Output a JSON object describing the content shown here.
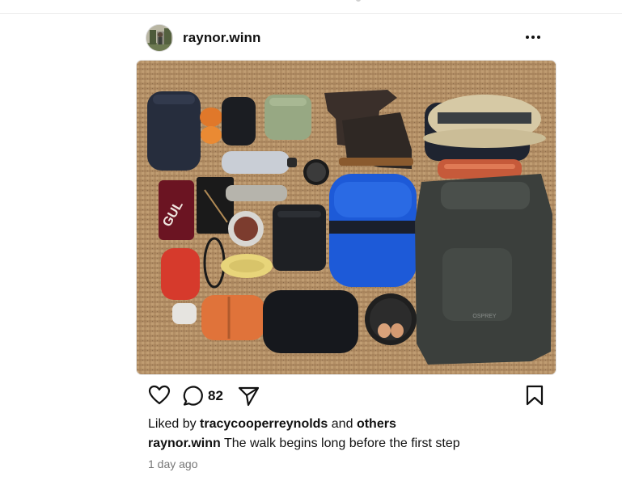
{
  "post": {
    "username": "raynor.winn",
    "comment_count": "82",
    "likes": {
      "prefix": "Liked by",
      "user": "tracycooperreynolds",
      "joiner": "and",
      "suffix": "others"
    },
    "caption": {
      "username": "raynor.winn",
      "text": "The walk begins long before the first step"
    },
    "timestamp": "1 day ago",
    "icons": {
      "more": "more-options-icon",
      "like": "heart-icon",
      "comment": "comment-bubble-icon",
      "share": "share-send-icon",
      "save": "bookmark-icon"
    },
    "photo": {
      "product_label": "GUL",
      "backpack_label": "OSPREY"
    }
  },
  "colors": {
    "text": "#111111",
    "muted": "#777777",
    "carpet": "#b7936a"
  }
}
